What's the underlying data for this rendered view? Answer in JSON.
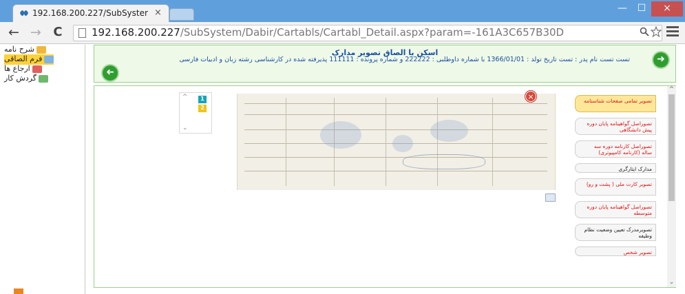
{
  "browser": {
    "tab_title": "192.168.200.227/SubSyster",
    "tab_close": "×",
    "url_host": "192.168.200.227",
    "url_path": "/SubSystem/Dabir/Cartabls/Cartabl_Detail.aspx?param=-161A3C657B30D",
    "window_buttons": {
      "minimize": "—",
      "maximize": "☐",
      "close": "×"
    },
    "nav": {
      "back": "←",
      "forward": "→",
      "reload": "C"
    }
  },
  "sidebar": {
    "items": [
      {
        "label": "شرح نامه",
        "icon": "note-icon",
        "color": "#f0b83a"
      },
      {
        "label": "فرم الصاقی",
        "icon": "form-icon",
        "color": "#7fb2e6"
      },
      {
        "label": "ارجاع ها",
        "icon": "refer-icon",
        "color": "#e25f5f"
      },
      {
        "label": "گردش کار",
        "icon": "workflow-icon",
        "color": "#6db86d"
      }
    ]
  },
  "header": {
    "title": "اسکن یا الصاق تصویر مدارک",
    "text": "تست تست نام پدر : تست تاریخ تولد : 1366/01/01 با شماره داوطلبی : 222222 و شماره پرونده : 111111 پذیرفته شده در کارشناسی رشته زبان و ادبیات فارسی"
  },
  "documents": {
    "items": [
      {
        "label": "تصویر تمامی صفحات شناسنامه",
        "style": "red first"
      },
      {
        "label": "تصوراصل گواهینامه پایان دوره پیش دانشگاهی",
        "style": "red"
      },
      {
        "label": "تصوراصل کارنامه دوره سه ساله (کارنامه کامپیوتری)",
        "style": "red"
      },
      {
        "label": "مدارک ایثارگری",
        "style": "black short"
      },
      {
        "label": "تصویر کارت ملی ( پشت و رو)",
        "style": "red"
      },
      {
        "label": "تصوراصل گواهینامه پایان دوره متوسطه",
        "style": "red"
      },
      {
        "label": "تصویرمدرک تعیین وضعیت نظام وظیفه",
        "style": "black"
      },
      {
        "label": "تصویر شخص",
        "style": "red short"
      }
    ]
  },
  "viewer": {
    "close_glyph": "×",
    "thumbnails": [
      "1",
      "2"
    ],
    "scroll_up": "^",
    "scroll_down": "⌄"
  }
}
